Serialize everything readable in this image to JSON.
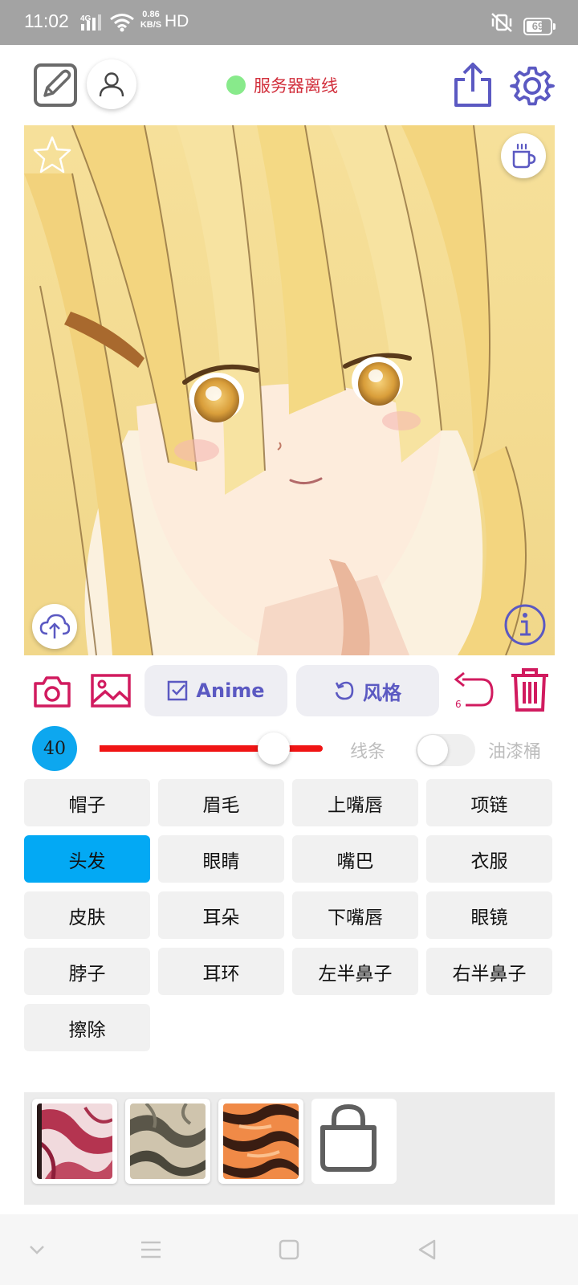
{
  "status_bar": {
    "time": "11:02",
    "network": "4G",
    "speed_value": "0.86",
    "speed_unit": "KB/S",
    "hd": "HD",
    "battery": "69",
    "battery_level": 0.69
  },
  "toolbar": {
    "server_status": "服务器离线",
    "server_status_color": "#d2303d",
    "status_dot_color": "#88ea8b",
    "accent_color": "#5b59c2"
  },
  "tools": {
    "model_label": "Anime",
    "style_label": "风格",
    "undo_count": "6",
    "pink_color": "#d11b5f"
  },
  "brush": {
    "size": "40",
    "slider_value": 0.78,
    "line_label": "线条",
    "bucket_label": "油漆桶",
    "bucket_enabled": false
  },
  "parts": [
    {
      "label": "帽子",
      "active": false
    },
    {
      "label": "眉毛",
      "active": false
    },
    {
      "label": "上嘴唇",
      "active": false
    },
    {
      "label": "项链",
      "active": false
    },
    {
      "label": "头发",
      "active": true
    },
    {
      "label": "眼睛",
      "active": false
    },
    {
      "label": "嘴巴",
      "active": false
    },
    {
      "label": "衣服",
      "active": false
    },
    {
      "label": "皮肤",
      "active": false
    },
    {
      "label": "耳朵",
      "active": false
    },
    {
      "label": "下嘴唇",
      "active": false
    },
    {
      "label": "眼镜",
      "active": false
    },
    {
      "label": "脖子",
      "active": false
    },
    {
      "label": "耳环",
      "active": false
    },
    {
      "label": "左半鼻子",
      "active": false
    },
    {
      "label": "右半鼻子",
      "active": false
    },
    {
      "label": "擦除",
      "active": false
    }
  ],
  "textures": [
    {
      "name": "red-marble-texture",
      "colors": [
        "#f1dadd",
        "#b43450"
      ]
    },
    {
      "name": "stone-texture",
      "colors": [
        "#cfc4ad",
        "#5a5649"
      ]
    },
    {
      "name": "tiger-stripe-texture",
      "colors": [
        "#f08a47",
        "#3a1d12"
      ]
    }
  ],
  "icons": {
    "draw": "pen-square-icon",
    "user": "user-icon",
    "share": "share-icon",
    "settings": "gear-icon",
    "favorite": "star-icon",
    "donate": "coffee-icon",
    "upload": "cloud-upload-icon",
    "info": "info-icon",
    "camera": "camera-icon",
    "gallery": "image-icon",
    "undo": "undo-icon",
    "delete": "trash-icon",
    "shop": "shopping-bag-icon"
  }
}
